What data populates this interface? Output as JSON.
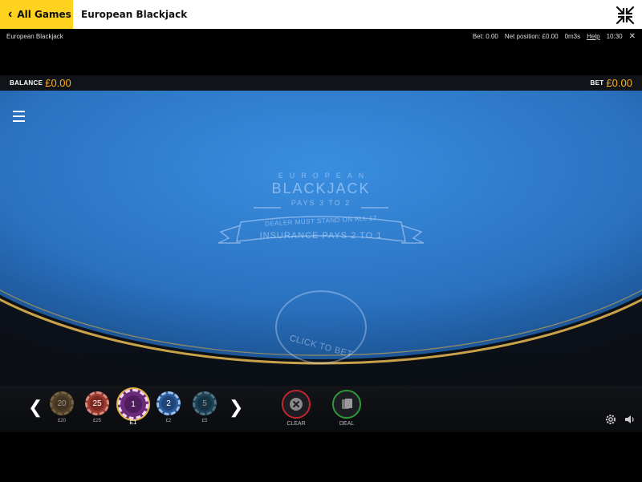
{
  "topbar": {
    "back_label": "All Games",
    "title": "European Blackjack"
  },
  "infobar": {
    "game_name": "European Blackjack",
    "bet": "Bet: 0.00",
    "net_position": "Net position: £0.00",
    "session_time": "0m3s",
    "help": "Help",
    "clock": "10:30",
    "close": "✕"
  },
  "balancebar": {
    "balance_label": "BALANCE",
    "balance_value": "£0.00",
    "bet_label": "BET",
    "bet_value": "£0.00"
  },
  "table": {
    "line1": "EUROPEAN",
    "line2": "BLACKJACK",
    "line3": "PAYS 3 TO 2",
    "ribbon1": "DEALER MUST STAND ON ALL 17",
    "ribbon2": "INSURANCE PAYS 2 TO 1",
    "bet_spot": "CLICK TO BET"
  },
  "chips": [
    {
      "value": "20",
      "label": "£20",
      "color": "#8a6a3a"
    },
    {
      "value": "25",
      "label": "£25",
      "color": "#9a3a30"
    },
    {
      "value": "1",
      "label": "£1",
      "color": "#6a2c7a",
      "selected": true
    },
    {
      "value": "2",
      "label": "£2",
      "color": "#2a5a9a"
    },
    {
      "value": "5",
      "label": "£5",
      "color": "#2a6a8a"
    }
  ],
  "nav": {
    "prev": "❮",
    "next": "❯"
  },
  "actions": {
    "clear_label": "CLEAR",
    "deal_label": "DEAL",
    "clear_color": "#c0262d",
    "deal_color": "#2e9a3a"
  },
  "colors": {
    "accent": "#ffd21f",
    "money": "#ffb21a",
    "felt": "#2f7fc8",
    "rail_gold": "#c9a24a"
  }
}
